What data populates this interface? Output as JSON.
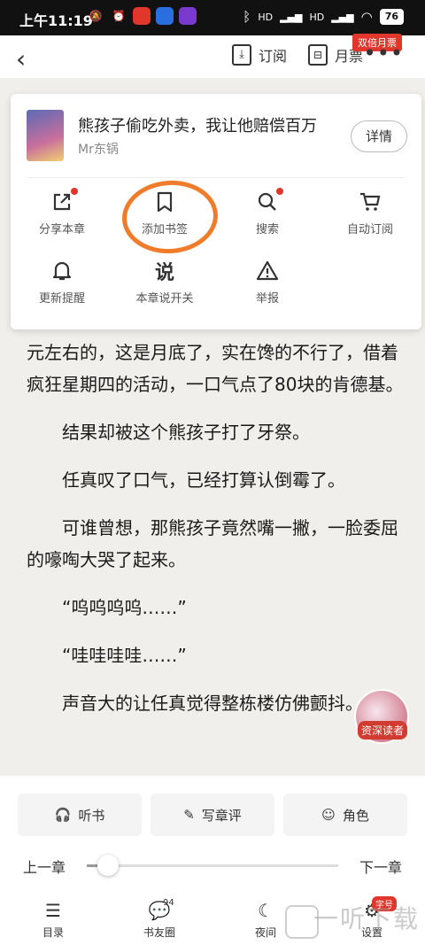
{
  "status": {
    "time": "上午11:19",
    "battery": "76",
    "signal1": "HD",
    "signal2": "HD"
  },
  "topbar": {
    "subscribe": "订阅",
    "monthly_ticket": "月票",
    "double_ticket_badge": "双倍月票"
  },
  "book": {
    "title": "熊孩子偷吃外卖，我让他赔偿百万",
    "author": "Mr东锅",
    "detail": "详情"
  },
  "menu": {
    "items": [
      {
        "label": "分享本章",
        "icon": "share-icon"
      },
      {
        "label": "添加书签",
        "icon": "bookmark-icon"
      },
      {
        "label": "搜索",
        "icon": "search-icon"
      },
      {
        "label": "自动订阅",
        "icon": "cart-icon"
      },
      {
        "label": "更新提醒",
        "icon": "bell-icon"
      },
      {
        "label": "本章说开关",
        "icon": "shuo-icon"
      },
      {
        "label": "举报",
        "icon": "warning-icon"
      }
    ]
  },
  "reading": {
    "paragraphs": [
      "元左右的，这是月底了，实在馋的不行了，借着疯狂星期四的活动，一口气点了80块的肯德基。",
      "结果却被这个熊孩子打了牙祭。",
      "任真叹了口气，已经打算认倒霉了。",
      "可谁曾想，那熊孩子竟然嘴一撇，一脸委屈的嚎啕大哭了起来。",
      "“呜呜呜呜……”",
      "“哇哇哇哇……”",
      "声音大的让任真觉得整栋楼仿佛颤抖。"
    ],
    "floater_tag": "资深读者",
    "progress": 0.05
  },
  "tools": {
    "listen": "听书",
    "review": "写章评",
    "role": "角色"
  },
  "chapter": {
    "prev": "上一章",
    "next": "下一章"
  },
  "nav": {
    "catalog": "目录",
    "friends": "书友圈",
    "friends_count": "94",
    "night": "夜间",
    "settings": "设置",
    "font_badge": "字号"
  },
  "watermark": "一听下载",
  "colors": {
    "accent_red": "#e0362c",
    "circle_orange": "#ee7c2a"
  }
}
